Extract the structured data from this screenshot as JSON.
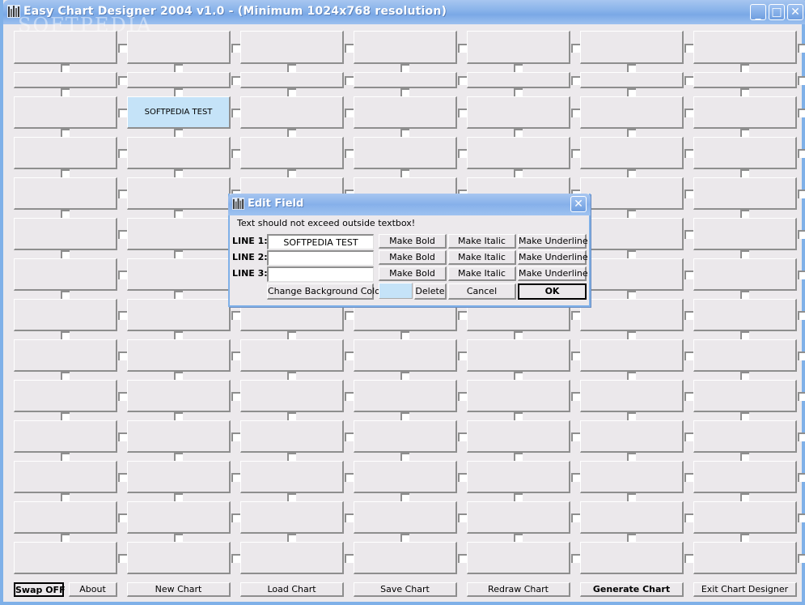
{
  "window": {
    "title": "Easy Chart Designer 2004 v1.0 - (Minimum 1024x768 resolution)",
    "controls": {
      "minimize": "_",
      "maximize": "□",
      "close": "✕"
    },
    "watermark": "SOFTPEDIA",
    "watermark_url": "www.softpedia.com"
  },
  "grid": {
    "columns": 7,
    "rows": 14,
    "filled_cells": [
      {
        "row": 2,
        "col": 1,
        "text": "SOFTPEDIA TEST",
        "background": "#c5e3f8"
      }
    ]
  },
  "toolbar": {
    "swap": "Swap OFF",
    "about": "About",
    "new_chart": "New Chart",
    "load_chart": "Load Chart",
    "save_chart": "Save Chart",
    "redraw_chart": "Redraw Chart",
    "generate_chart": "Generate Chart",
    "exit": "Exit Chart Designer"
  },
  "dialog": {
    "title": "Edit Field",
    "close": "✕",
    "warning": "Text should not exceed outside textbox!",
    "lines": [
      {
        "label": "LINE 1:",
        "value": "SOFTPEDIA TEST",
        "bold": "Make Bold",
        "italic": "Make Italic",
        "underline": "Make Underline"
      },
      {
        "label": "LINE 2:",
        "value": "",
        "bold": "Make Bold",
        "italic": "Make Italic",
        "underline": "Make Underline"
      },
      {
        "label": "LINE 3:",
        "value": "",
        "bold": "Make Bold",
        "italic": "Make Italic",
        "underline": "Make Underline"
      }
    ],
    "change_bg": "Change Background Color",
    "selected_color": "#c5e3f8",
    "delete": "Delete",
    "cancel": "Cancel",
    "ok": "OK"
  }
}
